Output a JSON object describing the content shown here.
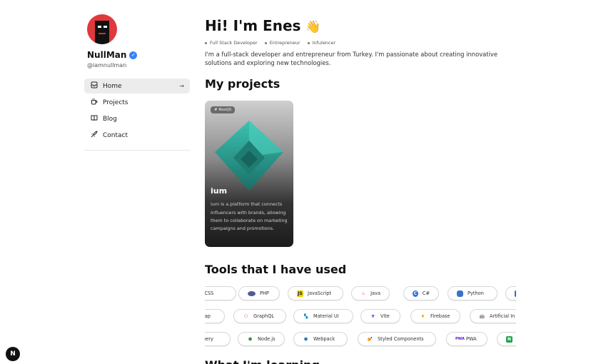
{
  "profile": {
    "name": "NullMan",
    "handle": "@iamnullman"
  },
  "nav": {
    "items": [
      {
        "label": "Home",
        "icon": "inbox-icon",
        "active": true
      },
      {
        "label": "Projects",
        "icon": "coffee-icon"
      },
      {
        "label": "Blog",
        "icon": "book-icon"
      },
      {
        "label": "Contact",
        "icon": "rocket-icon"
      }
    ]
  },
  "hero": {
    "title": "Hi! I'm Enes",
    "wave": "👋",
    "tags": [
      "Full Stack Developer",
      "Entrepreneur",
      "Infulencer"
    ],
    "intro": "I'm a full-stack developer and entrepreneur from Turkey. I'm passionate about creating innovative solutions and exploring new technologies."
  },
  "projects": {
    "heading": "My projects",
    "card": {
      "badge": "# NextJS",
      "title": "ium",
      "description": "ium is a platform that connects influencers with brands, allowing them to collaborate on marketing campaigns and promotions."
    }
  },
  "tools": {
    "heading": "Tools that I have used",
    "rows": [
      [
        "ndCSS",
        "PHP",
        "JavaScript",
        "Java",
        "C#",
        "Python",
        ""
      ],
      [
        "strap",
        "GraphQL",
        "Material UI",
        "Vite",
        "Firebase",
        "Artificial In"
      ],
      [
        "lquery",
        "Node.js",
        "Webpack",
        "Styled Components",
        "PWA",
        ""
      ]
    ]
  },
  "next_heading": "What I'm learning",
  "colors": {
    "accent": "#3b82f6",
    "gem": "#2aa89a"
  }
}
